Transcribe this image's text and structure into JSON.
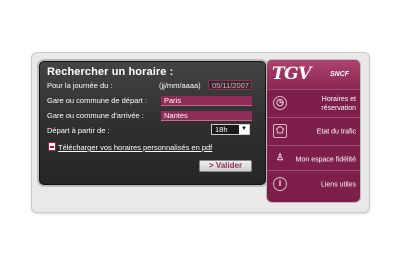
{
  "search": {
    "title": "Rechercher un horaire :",
    "date_label": "Pour la journée du :",
    "date_format": "(jj/mm/aaaa)",
    "date_value": "05/11/2007",
    "departure_label": "Gare ou commune de départ :",
    "departure_value": "Paris",
    "arrival_label": "Gare ou commune d'arrivée :",
    "arrival_value": "Nantes",
    "time_label": "Départ à partir de :",
    "time_value": "18h",
    "pdf_link": "Télécharger vos horaires personnalisés en pdf",
    "validate_label": "> Valider"
  },
  "sidebar": {
    "logo": "TGV",
    "brand": "SNCF",
    "items": [
      {
        "label": "Horaires et réservation",
        "icon": "clock-icon"
      },
      {
        "label": "Etat du trafic",
        "icon": "france-map-icon"
      },
      {
        "label": "Mon espace fidélité",
        "icon": "person-icon"
      },
      {
        "label": "Liens utiles",
        "icon": "info-icon"
      }
    ]
  },
  "colors": {
    "accent": "#8e2d58",
    "panel": "#2e2e2e",
    "sidebar": "#7d1f4a"
  }
}
